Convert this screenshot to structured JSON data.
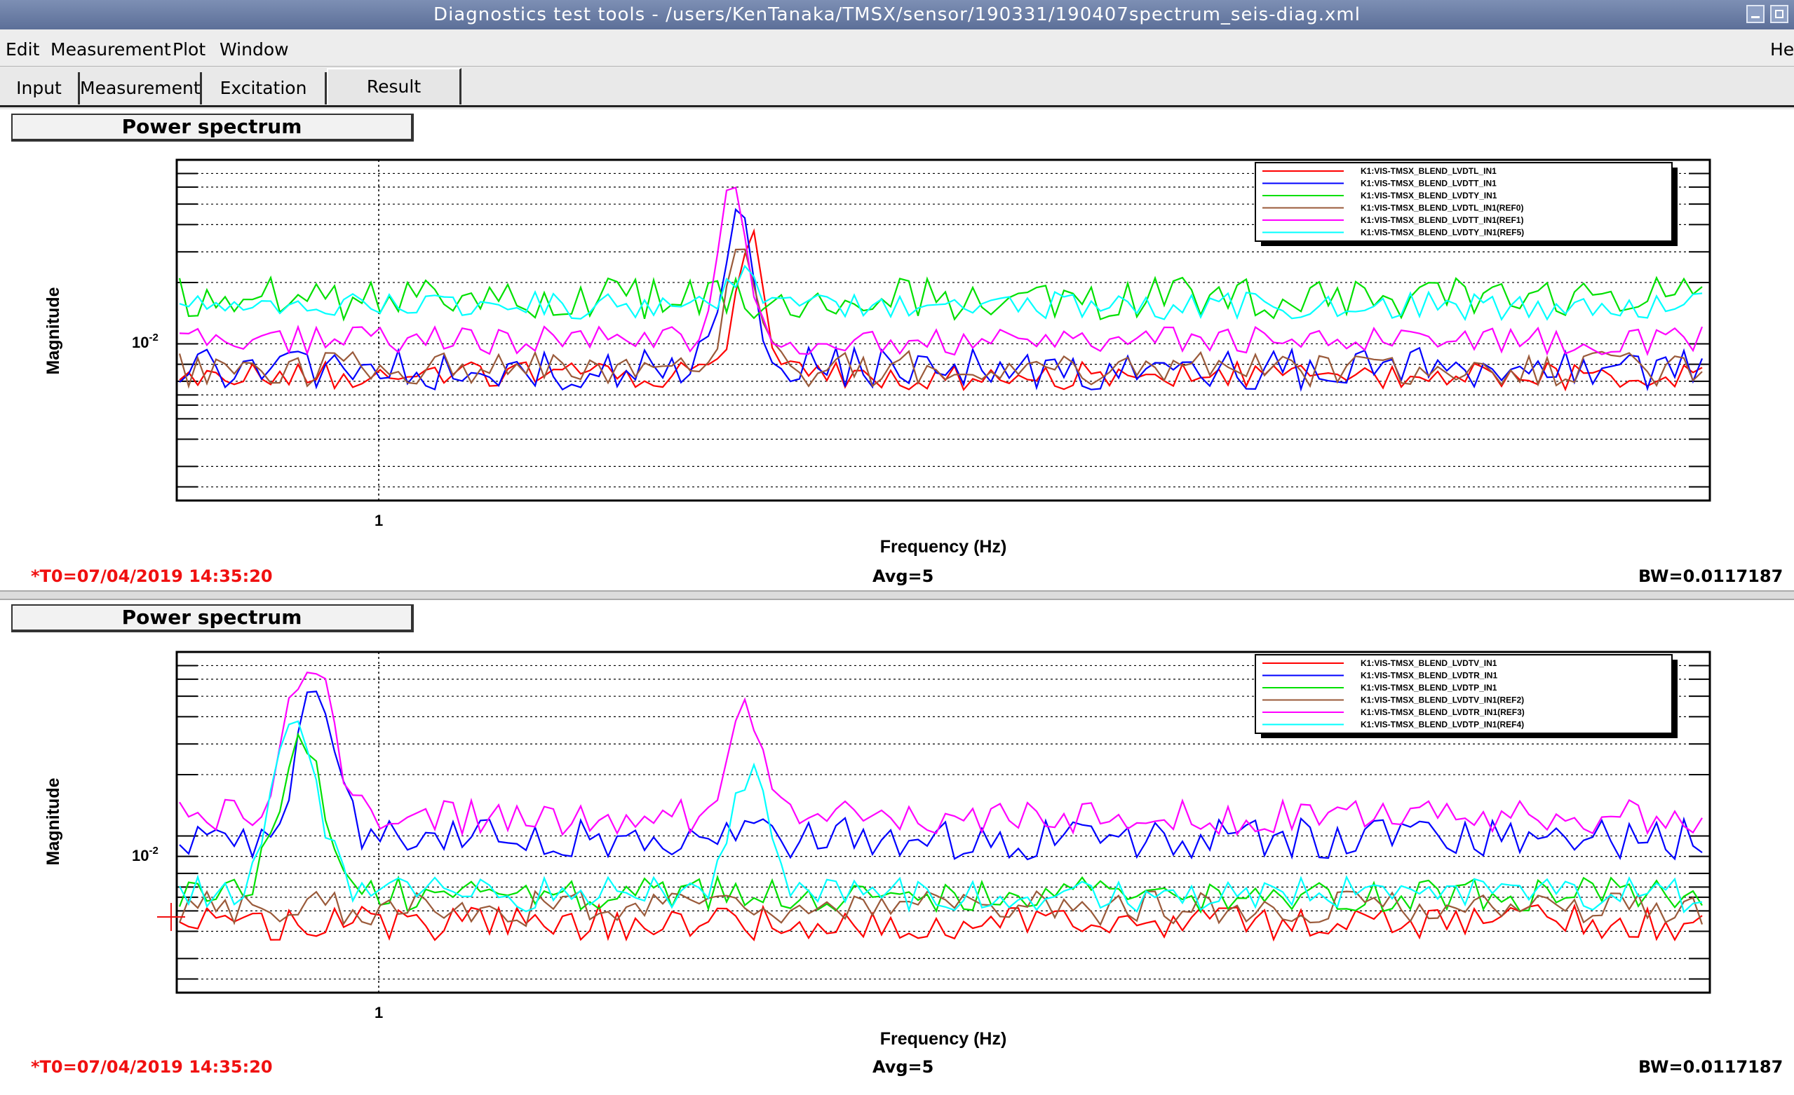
{
  "window": {
    "title": "Diagnostics test tools - /users/KenTanaka/TMSX/sensor/190331/190407spectrum_seis-diag.xml"
  },
  "menu": {
    "edit": "Edit",
    "measurement": "Measurement",
    "plot": "Plot",
    "window": "Window",
    "help": "He"
  },
  "tabs": [
    "Input",
    "Measurement",
    "Excitation",
    "Result"
  ],
  "colors": {
    "red": "#ff0000",
    "blue": "#0000ff",
    "green": "#00e000",
    "brown": "#9a5a3a",
    "magenta": "#ff00ff",
    "cyan": "#00ffff"
  },
  "panels": [
    {
      "title": "Power spectrum",
      "ylabel": "Magnitude",
      "xlabel": "Frequency (Hz)",
      "x_tick": "1",
      "y_tick_base": "10",
      "y_tick_exp": "-2",
      "t0": "*T0=07/04/2019 14:35:20",
      "avg": "Avg=5",
      "bw": "BW=0.0117187",
      "legend": [
        "K1:VIS-TMSX_BLEND_LVDTL_IN1",
        "K1:VIS-TMSX_BLEND_LVDTT_IN1",
        "K1:VIS-TMSX_BLEND_LVDTY_IN1",
        "K1:VIS-TMSX_BLEND_LVDTL_IN1(REF0)",
        "K1:VIS-TMSX_BLEND_LVDTT_IN1(REF1)",
        "K1:VIS-TMSX_BLEND_LVDTY_IN1(REF5)"
      ]
    },
    {
      "title": "Power spectrum",
      "ylabel": "Magnitude",
      "xlabel": "Frequency (Hz)",
      "x_tick": "1",
      "y_tick_base": "10",
      "y_tick_exp": "-2",
      "t0": "*T0=07/04/2019 14:35:20",
      "avg": "Avg=5",
      "bw": "BW=0.0117187",
      "legend": [
        "K1:VIS-TMSX_BLEND_LVDTV_IN1",
        "K1:VIS-TMSX_BLEND_LVDTR_IN1",
        "K1:VIS-TMSX_BLEND_LVDTP_IN1",
        "K1:VIS-TMSX_BLEND_LVDTV_IN1(REF2)",
        "K1:VIS-TMSX_BLEND_LVDTR_IN1(REF3)",
        "K1:VIS-TMSX_BLEND_LVDTP_IN1(REF4)"
      ]
    }
  ]
}
